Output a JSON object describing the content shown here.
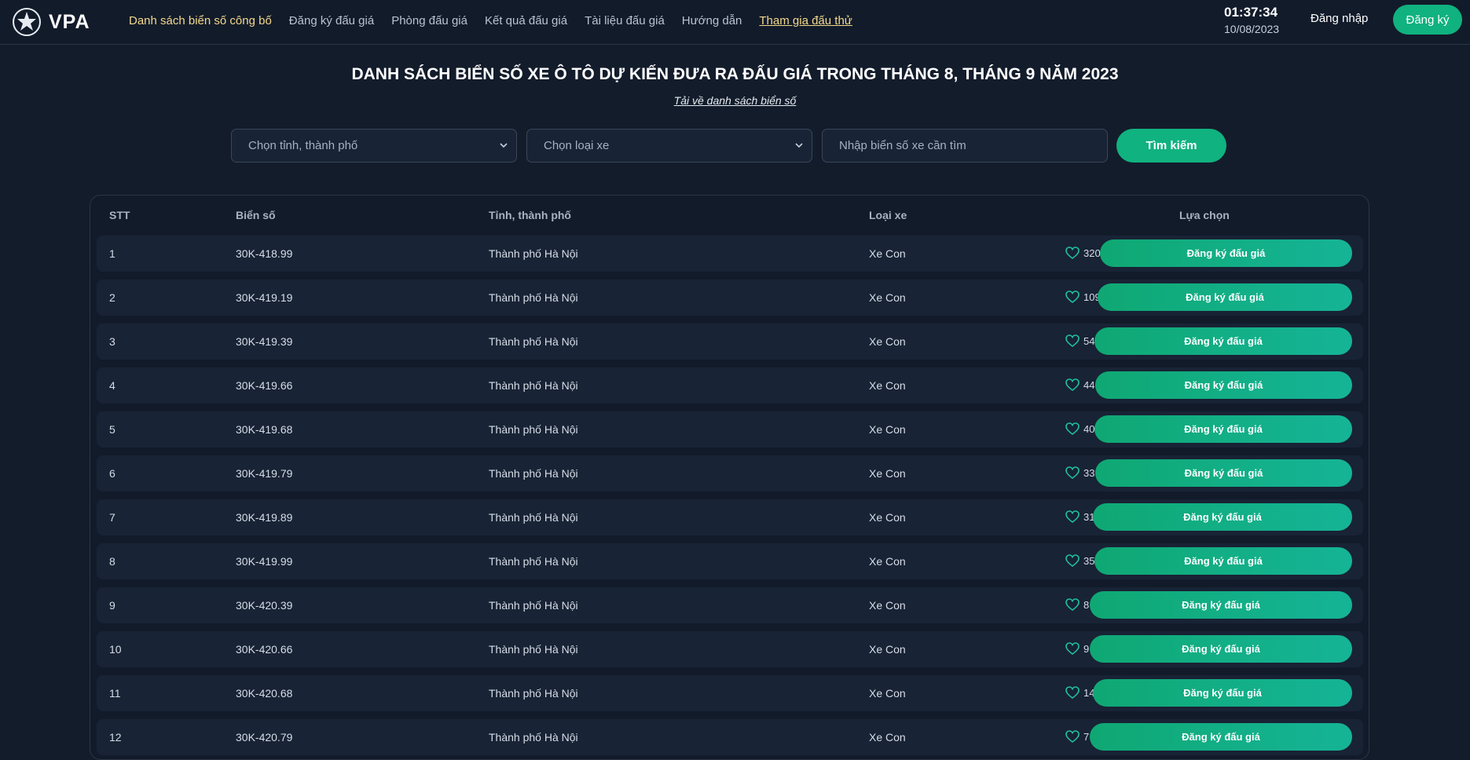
{
  "header": {
    "logo_text": "VPA",
    "nav": [
      {
        "label": "Danh sách biển số công bố"
      },
      {
        "label": "Đăng ký đấu giá"
      },
      {
        "label": "Phòng đấu giá"
      },
      {
        "label": "Kết quả đấu giá"
      },
      {
        "label": "Tài liệu đấu giá"
      },
      {
        "label": "Hướng dẫn"
      },
      {
        "label": "Tham gia đấu thử"
      }
    ],
    "clock_time": "01:37:34",
    "clock_date": "10/08/2023",
    "login_label": "Đăng nhập",
    "signup_label": "Đăng ký"
  },
  "main": {
    "title": "DANH SÁCH BIỂN SỐ XE Ô TÔ DỰ KIẾN ĐƯA RA ĐẤU GIÁ TRONG THÁNG 8, THÁNG 9 NĂM 2023",
    "download_label": "Tải về danh sách biển số"
  },
  "filters": {
    "province_placeholder": "Chọn tỉnh, thành phố",
    "vehicle_placeholder": "Chọn loại xe",
    "plate_placeholder": "Nhập biển số xe cần tìm",
    "search_label": "Tìm kiếm"
  },
  "table": {
    "headers": {
      "stt": "STT",
      "plate": "Biển số",
      "province": "Tỉnh, thành phố",
      "vehicle": "Loại xe",
      "action": "Lựa chọn"
    },
    "register_label": "Đăng ký đấu giá",
    "rows": [
      {
        "stt": "1",
        "plate": "30K-418.99",
        "province": "Thành phố Hà Nội",
        "vehicle": "Xe Con",
        "likes": "320"
      },
      {
        "stt": "2",
        "plate": "30K-419.19",
        "province": "Thành phố Hà Nội",
        "vehicle": "Xe Con",
        "likes": "109"
      },
      {
        "stt": "3",
        "plate": "30K-419.39",
        "province": "Thành phố Hà Nội",
        "vehicle": "Xe Con",
        "likes": "54"
      },
      {
        "stt": "4",
        "plate": "30K-419.66",
        "province": "Thành phố Hà Nội",
        "vehicle": "Xe Con",
        "likes": "44"
      },
      {
        "stt": "5",
        "plate": "30K-419.68",
        "province": "Thành phố Hà Nội",
        "vehicle": "Xe Con",
        "likes": "40"
      },
      {
        "stt": "6",
        "plate": "30K-419.79",
        "province": "Thành phố Hà Nội",
        "vehicle": "Xe Con",
        "likes": "33"
      },
      {
        "stt": "7",
        "plate": "30K-419.89",
        "province": "Thành phố Hà Nội",
        "vehicle": "Xe Con",
        "likes": "31"
      },
      {
        "stt": "8",
        "plate": "30K-419.99",
        "province": "Thành phố Hà Nội",
        "vehicle": "Xe Con",
        "likes": "35"
      },
      {
        "stt": "9",
        "plate": "30K-420.39",
        "province": "Thành phố Hà Nội",
        "vehicle": "Xe Con",
        "likes": "8"
      },
      {
        "stt": "10",
        "plate": "30K-420.66",
        "province": "Thành phố Hà Nội",
        "vehicle": "Xe Con",
        "likes": "9"
      },
      {
        "stt": "11",
        "plate": "30K-420.68",
        "province": "Thành phố Hà Nội",
        "vehicle": "Xe Con",
        "likes": "14"
      },
      {
        "stt": "12",
        "plate": "30K-420.79",
        "province": "Thành phố Hà Nội",
        "vehicle": "Xe Con",
        "likes": "7"
      }
    ]
  },
  "colors": {
    "background": "#131c2b",
    "accent": "#10b27f",
    "nav_active": "#f3d98b"
  },
  "icons": {
    "logo": "emblem-star-icon",
    "chevron": "chevron-down-icon",
    "like": "heart-icon"
  }
}
